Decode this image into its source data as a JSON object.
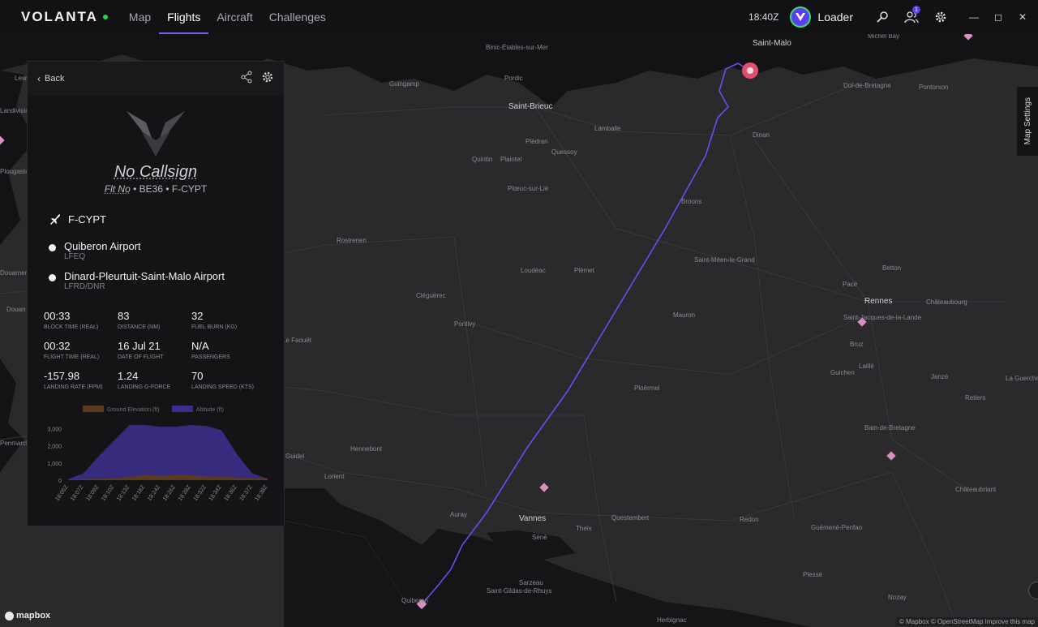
{
  "topbar": {
    "brand": "VOLANTA",
    "tabs": [
      {
        "label": "Map",
        "active": false
      },
      {
        "label": "Flights",
        "active": true
      },
      {
        "label": "Aircraft",
        "active": false
      },
      {
        "label": "Challenges",
        "active": false
      }
    ],
    "clock": "18:40Z",
    "username": "Loader",
    "notification_count": "1",
    "icons": [
      "search-icon",
      "friends-icon",
      "gear-icon"
    ],
    "window_controls": [
      "minimize-icon",
      "maximize-icon",
      "close-icon"
    ]
  },
  "panel": {
    "back_label": "Back",
    "callsign": "No Callsign",
    "flt_no": "Flt No",
    "aircraft_type": "BE36",
    "registration": "F-CYPT",
    "sep": "•",
    "departure": {
      "name": "Quiberon Airport",
      "code": "LFEQ"
    },
    "arrival": {
      "name": "Dinard-Pleurtuit-Saint-Malo Airport",
      "code": "LFRD/DNR"
    },
    "stats": [
      {
        "value": "00:33",
        "label": "BLOCK TIME (REAL)"
      },
      {
        "value": "83",
        "label": "DISTANCE (NM)"
      },
      {
        "value": "32",
        "label": "FUEL BURN (KG)"
      },
      {
        "value": "00:32",
        "label": "FLIGHT TIME (REAL)"
      },
      {
        "value": "16 Jul 21",
        "label": "DATE OF FLIGHT"
      },
      {
        "value": "N/A",
        "label": "PASSENGERS"
      },
      {
        "value": "-157.98",
        "label": "LANDING RATE (FPM)"
      },
      {
        "value": "1.24",
        "label": "LANDING G-FORCE"
      },
      {
        "value": "70",
        "label": "LANDING SPEED (KTS)"
      }
    ]
  },
  "chart_data": {
    "type": "area",
    "legend": [
      {
        "name": "Ground Elevation (ft)",
        "color": "#5a3a1f"
      },
      {
        "name": "Altitude (ft)",
        "color": "#3b2d8a"
      }
    ],
    "x": [
      "18:05Z",
      "18:07Z",
      "18:09Z",
      "18:10Z",
      "18:13Z",
      "18:18Z",
      "18:24Z",
      "18:26Z",
      "18:28Z",
      "18:32Z",
      "18:34Z",
      "18:36Z",
      "18:37Z",
      "18:38Z"
    ],
    "yticks": [
      "3,000",
      "2,000",
      "1,000",
      "0"
    ],
    "ylim": [
      0,
      3200
    ],
    "series": [
      {
        "name": "Altitude (ft)",
        "values": [
          50,
          400,
          1400,
          2300,
          3200,
          3200,
          3100,
          3100,
          3200,
          3150,
          2900,
          1500,
          400,
          80
        ]
      },
      {
        "name": "Ground Elevation (ft)",
        "values": [
          30,
          60,
          80,
          100,
          200,
          300,
          250,
          300,
          280,
          220,
          200,
          150,
          100,
          100
        ]
      }
    ]
  },
  "map": {
    "labels": [
      {
        "text": "Saint-Malo",
        "cls": "big"
      },
      {
        "text": "Binic-Étables-sur-Mer",
        "cls": ""
      },
      {
        "text": "Pordic",
        "cls": ""
      },
      {
        "text": "Guingamp",
        "cls": ""
      },
      {
        "text": "Saint-Brieuc",
        "cls": "big"
      },
      {
        "text": "Lamballe",
        "cls": ""
      },
      {
        "text": "Plédran",
        "cls": ""
      },
      {
        "text": "Quessoy",
        "cls": ""
      },
      {
        "text": "Quintin",
        "cls": ""
      },
      {
        "text": "Plaintel",
        "cls": ""
      },
      {
        "text": "Plœuc-sur-Lié",
        "cls": ""
      },
      {
        "text": "Dinan",
        "cls": ""
      },
      {
        "text": "Dol-de-Bretagne",
        "cls": ""
      },
      {
        "text": "Pontorson",
        "cls": ""
      },
      {
        "text": "Michel Bay",
        "cls": ""
      },
      {
        "text": "Broons",
        "cls": ""
      },
      {
        "text": "Rostrenen",
        "cls": ""
      },
      {
        "text": "Loudéac",
        "cls": ""
      },
      {
        "text": "Plémet",
        "cls": ""
      },
      {
        "text": "Saint-Méen-le-Grand",
        "cls": ""
      },
      {
        "text": "Betton",
        "cls": ""
      },
      {
        "text": "Pacé",
        "cls": ""
      },
      {
        "text": "Rennes",
        "cls": "big"
      },
      {
        "text": "Saint-Jacques-de-la-Lande",
        "cls": ""
      },
      {
        "text": "Châteaubourg",
        "cls": ""
      },
      {
        "text": "Cléguérec",
        "cls": ""
      },
      {
        "text": "Mauron",
        "cls": ""
      },
      {
        "text": "Pontivy",
        "cls": ""
      },
      {
        "text": "Le Faouët",
        "cls": ""
      },
      {
        "text": "Bruz",
        "cls": ""
      },
      {
        "text": "Laillé",
        "cls": ""
      },
      {
        "text": "Guichen",
        "cls": ""
      },
      {
        "text": "Janzé",
        "cls": ""
      },
      {
        "text": "Retiers",
        "cls": ""
      },
      {
        "text": "La Guerche",
        "cls": ""
      },
      {
        "text": "Ploërmel",
        "cls": ""
      },
      {
        "text": "Bain-de-Bretagne",
        "cls": ""
      },
      {
        "text": "Hennebont",
        "cls": ""
      },
      {
        "text": "Lorient",
        "cls": ""
      },
      {
        "text": "Guidel",
        "cls": ""
      },
      {
        "text": "Châteaubriant",
        "cls": ""
      },
      {
        "text": "Auray",
        "cls": ""
      },
      {
        "text": "Vannes",
        "cls": "big"
      },
      {
        "text": "Questembert",
        "cls": ""
      },
      {
        "text": "Séné",
        "cls": ""
      },
      {
        "text": "Theix",
        "cls": ""
      },
      {
        "text": "Redon",
        "cls": ""
      },
      {
        "text": "Guémené-Penfao",
        "cls": ""
      },
      {
        "text": "Sarzeau",
        "cls": ""
      },
      {
        "text": "Saint-Gildas-de-Rhuys",
        "cls": ""
      },
      {
        "text": "Quiberon",
        "cls": ""
      },
      {
        "text": "Plessé",
        "cls": ""
      },
      {
        "text": "Nozay",
        "cls": ""
      },
      {
        "text": "Herbignac",
        "cls": ""
      },
      {
        "text": "Douarnenez",
        "cls": ""
      },
      {
        "text": "Penmarch",
        "cls": ""
      },
      {
        "text": "Lesneven",
        "cls": ""
      },
      {
        "text": "Landivisiau",
        "cls": ""
      },
      {
        "text": "Plougastel",
        "cls": ""
      },
      {
        "text": "Douan",
        "cls": ""
      }
    ],
    "settings_label": "Map Settings",
    "attribution": "© Mapbox © OpenStreetMap Improve this map",
    "mapbox": "mapbox"
  }
}
